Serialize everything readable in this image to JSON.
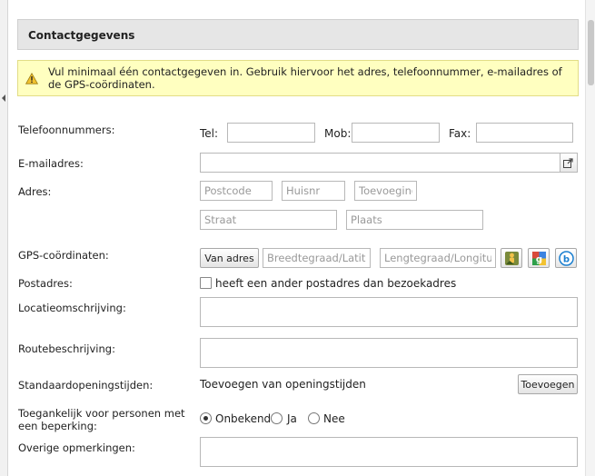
{
  "section": {
    "title": "Contactgegevens"
  },
  "notice": {
    "text": "Vul minimaal één contactgegeven in. Gebruik hiervoor het adres, telefoonnummer, e-mailadres of de GPS-coördinaten.",
    "icon": "warning-icon"
  },
  "phone": {
    "label": "Telefoonnummers:",
    "tel_label": "Tel:",
    "tel_value": "",
    "mob_label": "Mob:",
    "mob_value": "",
    "fax_label": "Fax:",
    "fax_value": ""
  },
  "email": {
    "label": "E-mailadres:",
    "value": "",
    "open_icon": "external-link-icon"
  },
  "address": {
    "label": "Adres:",
    "postcode_placeholder": "Postcode",
    "huisnr_placeholder": "Huisnr",
    "toevoeging_placeholder": "Toevoeging",
    "straat_placeholder": "Straat",
    "plaats_placeholder": "Plaats"
  },
  "gps": {
    "label": "GPS-coördinaten:",
    "from_address_button": "Van adres",
    "latitude_placeholder": "Breedtegraad/Latitude",
    "longitude_placeholder": "Lengtegraad/Longitude",
    "icons": [
      "streetview-icon",
      "google-maps-icon",
      "bing-maps-icon"
    ]
  },
  "postal": {
    "label": "Postadres:",
    "checkbox_label": "heeft een ander postadres dan bezoekadres",
    "checked": false
  },
  "location_description": {
    "label": "Locatieomschrijving:",
    "value": ""
  },
  "route_description": {
    "label": "Routebeschrijving:",
    "value": ""
  },
  "opening_hours": {
    "label": "Standaardopeningstijden:",
    "text": "Toevoegen van openingstijden",
    "button": "Toevoegen"
  },
  "accessibility": {
    "label": "Toegankelijk voor personen met een beperking:",
    "options": [
      "Onbekend",
      "Ja",
      "Nee"
    ],
    "selected": "Onbekend"
  },
  "other_remarks": {
    "label": "Overige opmerkingen:",
    "value": ""
  },
  "colors": {
    "header_bg": "#e6e6e6",
    "notice_bg": "#ffffc0",
    "notice_border": "#e2dd86"
  }
}
